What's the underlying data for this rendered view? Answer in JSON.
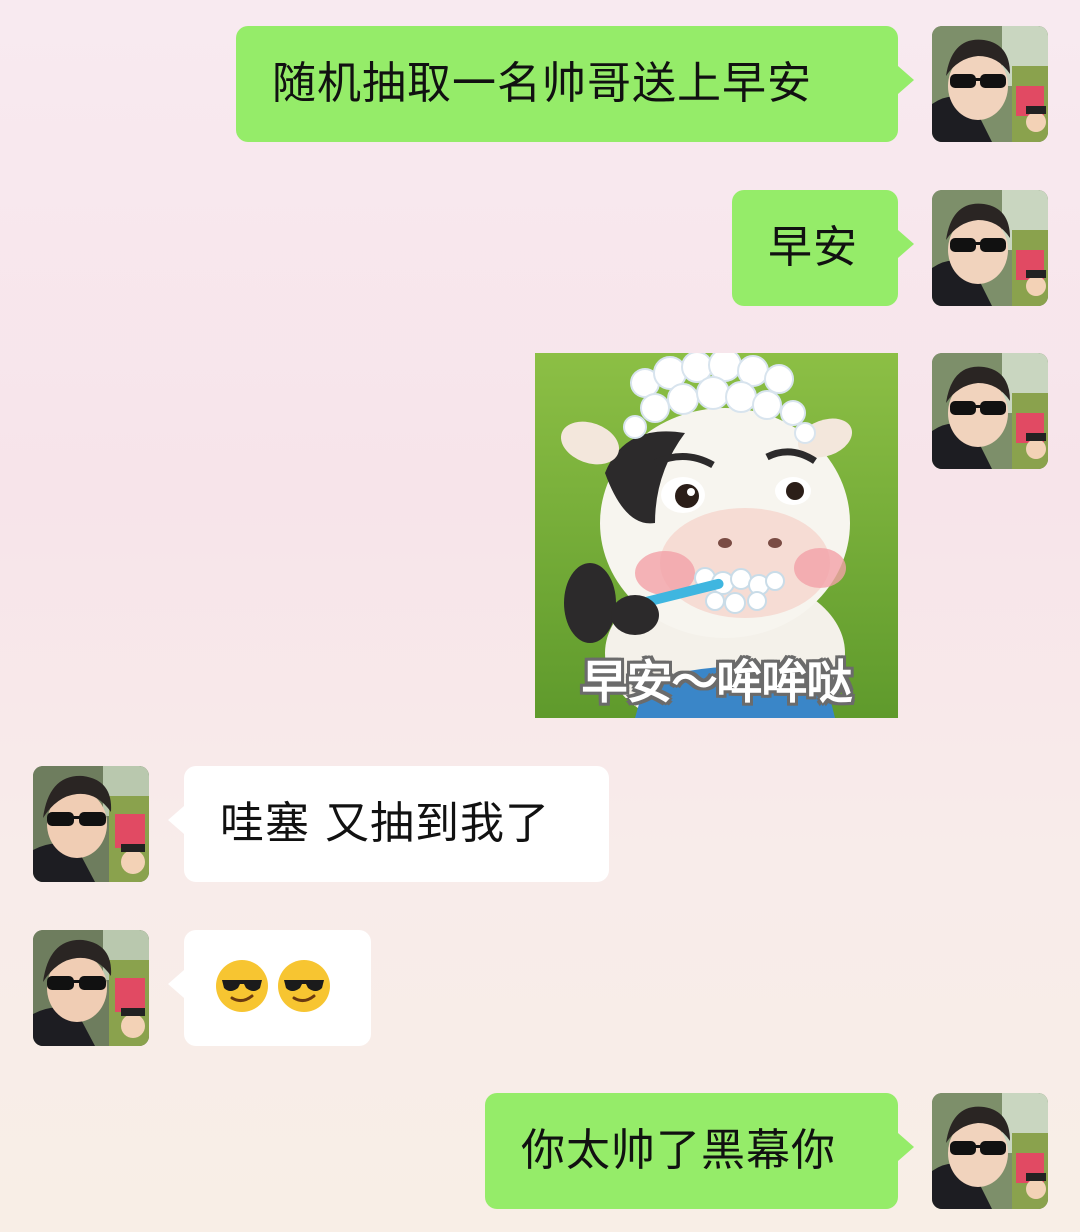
{
  "theme": {
    "sent_bubble_color": "#95ec69",
    "received_bubble_color": "#ffffff",
    "background_tint": "#f8eaf0"
  },
  "messages": [
    {
      "side": "right",
      "type": "text",
      "text": "随机抽取一名帅哥送上早安"
    },
    {
      "side": "right",
      "type": "text",
      "text": "早安"
    },
    {
      "side": "right",
      "type": "sticker",
      "caption": "早安～哞哞哒",
      "icon": "cow-brushing-teeth-sticker"
    },
    {
      "side": "left",
      "type": "text",
      "text": "哇塞 又抽到我了"
    },
    {
      "side": "left",
      "type": "emoji",
      "emojis": [
        "smiling-face-with-sunglasses",
        "smiling-face-with-sunglasses"
      ]
    },
    {
      "side": "right",
      "type": "text",
      "text": "你太帅了黑幕你"
    }
  ]
}
